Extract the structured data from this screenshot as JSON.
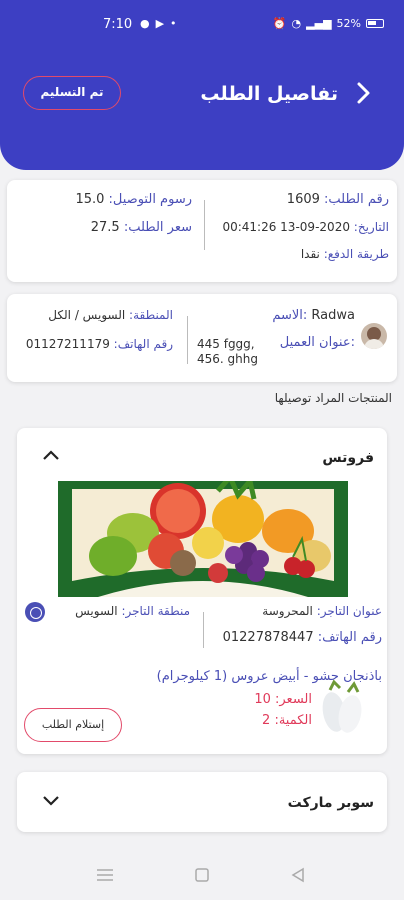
{
  "status_bar": {
    "time": "7:10",
    "battery": "52%"
  },
  "header": {
    "title": "تفاصيل الطلب",
    "status_button": "تم التسليم"
  },
  "order": {
    "number_label": "رقم الطلب:",
    "number": "1609",
    "date_label": "التاريخ:",
    "date": "2020-09-13 00:41:26",
    "payment_label": "طريقة الدفع:",
    "payment": "نقدا",
    "delivery_fee_label": "رسوم التوصيل:",
    "delivery_fee": "15.0",
    "price_label": "سعر الطلب:",
    "price": "27.5"
  },
  "customer": {
    "name_label": "الاسم:",
    "name": "Radwa",
    "address_label": "عنوان العميل:",
    "address": "445 fggg, 456. ghhg",
    "region_label": "المنطقة:",
    "region": "السويس / الكل",
    "phone_label": "رقم الهاتف:",
    "phone": "01127211179"
  },
  "products_heading": "المنتجات المراد توصيلها",
  "stores": [
    {
      "name": "فروتس",
      "merchant_address_label": "عنوان التاجر:",
      "merchant_address": "المحروسة",
      "merchant_phone_label": "رقم الهاتف:",
      "merchant_phone": "01227878447",
      "merchant_region_label": "منطقة التاجر:",
      "merchant_region": "السويس",
      "product_name": "باذنجان حشو - أبيض عروس (1 كيلوجرام)",
      "price_text": "السعر: 10",
      "qty_text": "الكمية: 2",
      "receive_button": "إستلام الطلب"
    },
    {
      "name": "سوبر ماركت"
    }
  ],
  "colors": {
    "primary": "#3d3fc3",
    "accent": "#e24a6a",
    "label": "#4a4fb5"
  }
}
